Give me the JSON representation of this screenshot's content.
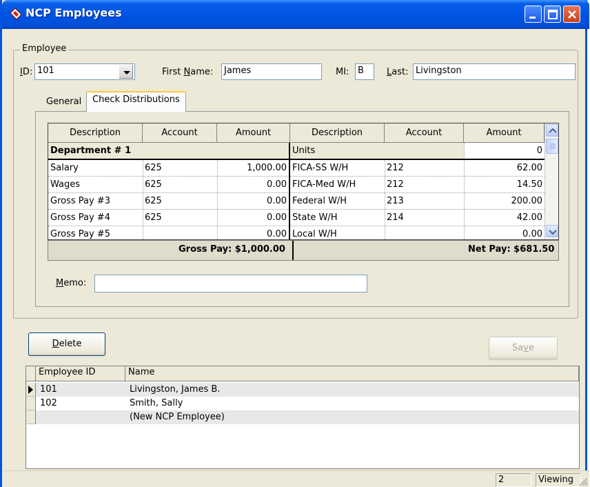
{
  "window": {
    "title": "NCP Employees"
  },
  "employee": {
    "group_label": "Employee",
    "id_label": "ID:",
    "id_value": "101",
    "first_name_label": "First Name:",
    "first_name_value": "James",
    "mi_label": "MI:",
    "mi_value": "B",
    "last_label": "Last:",
    "last_value": "Livingston"
  },
  "tabs": [
    {
      "label": "General",
      "active": false
    },
    {
      "label": "Check Distributions",
      "active": true
    }
  ],
  "distributions": {
    "left_headers": [
      "Description",
      "Account",
      "Amount"
    ],
    "right_headers": [
      "Description",
      "Account",
      "Amount"
    ],
    "department_row": {
      "left_label": "Department # 1",
      "right_label": "Units",
      "right_amount": "0"
    },
    "rows": [
      {
        "left_desc": "Salary",
        "left_account": "625",
        "left_amount": "1,000.00",
        "right_desc": "FICA-SS W/H",
        "right_account": "212",
        "right_amount": "62.00"
      },
      {
        "left_desc": "Wages",
        "left_account": "625",
        "left_amount": "0.00",
        "right_desc": "FICA-Med W/H",
        "right_account": "212",
        "right_amount": "14.50"
      },
      {
        "left_desc": "Gross Pay #3",
        "left_account": "625",
        "left_amount": "0.00",
        "right_desc": "Federal W/H",
        "right_account": "213",
        "right_amount": "200.00"
      },
      {
        "left_desc": "Gross Pay #4",
        "left_account": "625",
        "left_amount": "0.00",
        "right_desc": "State W/H",
        "right_account": "214",
        "right_amount": "42.00"
      },
      {
        "left_desc": "Gross Pay #5",
        "left_account": "",
        "left_amount": "0.00",
        "right_desc": "Local W/H",
        "right_account": "",
        "right_amount": "0.00"
      }
    ],
    "gross_pay": "Gross Pay: $1,000.00",
    "net_pay": "Net Pay: $681.50"
  },
  "memo": {
    "label": "Memo:",
    "value": ""
  },
  "buttons": {
    "delete": "Delete",
    "save": "Save"
  },
  "employee_list": {
    "headers": [
      "Employee ID",
      "Name"
    ],
    "rows": [
      {
        "id": "101",
        "name": "Livingston, James B."
      },
      {
        "id": "102",
        "name": "Smith, Sally"
      },
      {
        "id": "",
        "name": "(New NCP Employee)"
      }
    ]
  },
  "status": {
    "count": "2",
    "mode": "Viewing"
  },
  "colors": {
    "titlebar": "#0054e3",
    "window_bg": "#ece9d8",
    "tab_highlight": "#ffc83c"
  },
  "icons": [
    "app-icon",
    "minimize-icon",
    "maximize-icon",
    "close-icon",
    "dropdown-arrow-icon",
    "scroll-up-icon",
    "scroll-down-icon",
    "row-pointer-icon",
    "resize-grip-icon"
  ]
}
